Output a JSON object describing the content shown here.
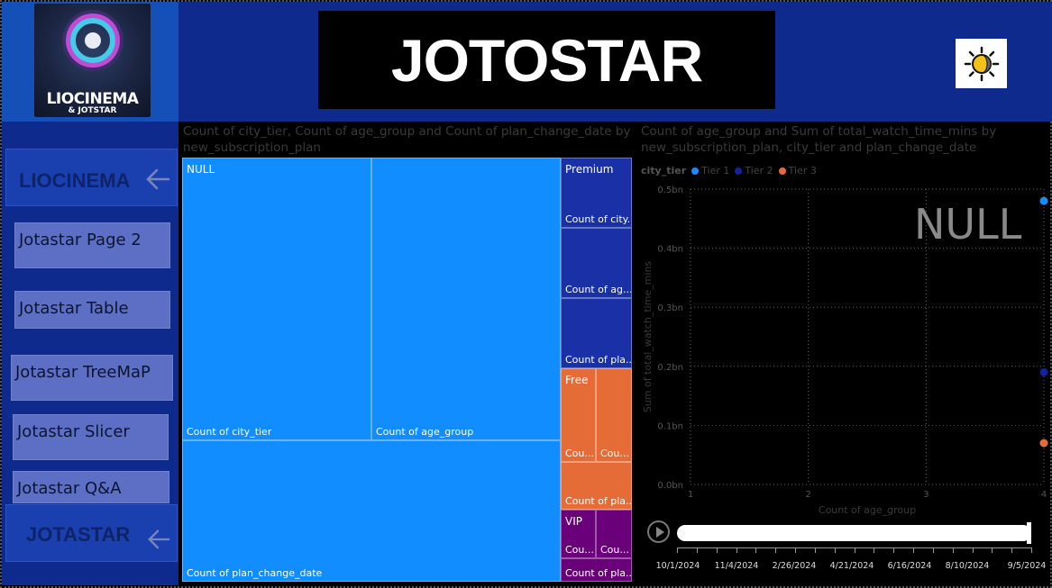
{
  "header": {
    "title": "JOTOSTAR",
    "logo_text_main": "LIOCINEMA",
    "logo_text_sub": "& JOTSTAR"
  },
  "nav": {
    "top_label": "LIOCINEMA",
    "bottom_label": "JOTASTAR",
    "buttons": [
      "Jotastar Page 2",
      "Jotastar Table",
      "Jotastar TreeMaP",
      "Jotastar Slicer",
      "Jotastar Q&A"
    ]
  },
  "treemap": {
    "title": "Count of city_tier, Count of age_group and Count of plan_change_date by new_subscription_plan",
    "groups": [
      {
        "name": "NULL",
        "color": "#118dff",
        "tiles": [
          "Count of city_tier",
          "Count of age_group",
          "Count of plan_change_date"
        ]
      },
      {
        "name": "Premium",
        "color": "#1a30a6",
        "tiles": [
          "Count of city...",
          "Count of ag...",
          "Count of pla..."
        ]
      },
      {
        "name": "Free",
        "color": "#e66c37",
        "tiles": [
          "Cou...",
          "Cou...",
          "Count of pla..."
        ]
      },
      {
        "name": "VIP",
        "color": "#6b007b",
        "tiles": [
          "Cou...",
          "Cou...",
          "Count of pla..."
        ]
      }
    ]
  },
  "chart_data": {
    "type": "scatter",
    "title": "Count of age_group and Sum of total_watch_time_mins by new_subscription_plan, city_tier and plan_change_date",
    "xlabel": "Count of age_group",
    "ylabel": "Sum of total_watch_time_mins",
    "xlim": [
      1,
      4
    ],
    "ylim": [
      0,
      0.5
    ],
    "x_ticks": [
      "1",
      "2",
      "3",
      "4"
    ],
    "y_ticks": [
      "0.0bn",
      "0.1bn",
      "0.2bn",
      "0.3bn",
      "0.4bn",
      "0.5bn"
    ],
    "legend_title": "city_tier",
    "legend_position": "top-left",
    "grid": true,
    "series": [
      {
        "name": "Tier 1",
        "color": "#118dff",
        "points": [
          {
            "x": 4,
            "y": 0.48
          }
        ]
      },
      {
        "name": "Tier 2",
        "color": "#12239e",
        "points": [
          {
            "x": 4,
            "y": 0.19
          }
        ]
      },
      {
        "name": "Tier 3",
        "color": "#e66c37",
        "points": [
          {
            "x": 4,
            "y": 0.07
          }
        ]
      }
    ],
    "play_axis_label": "NULL",
    "play_axis_dates": [
      "10/1/2024",
      "11/4/2024",
      "2/26/2024",
      "4/21/2024",
      "6/16/2024",
      "8/10/2024",
      "9/5/2024"
    ]
  }
}
